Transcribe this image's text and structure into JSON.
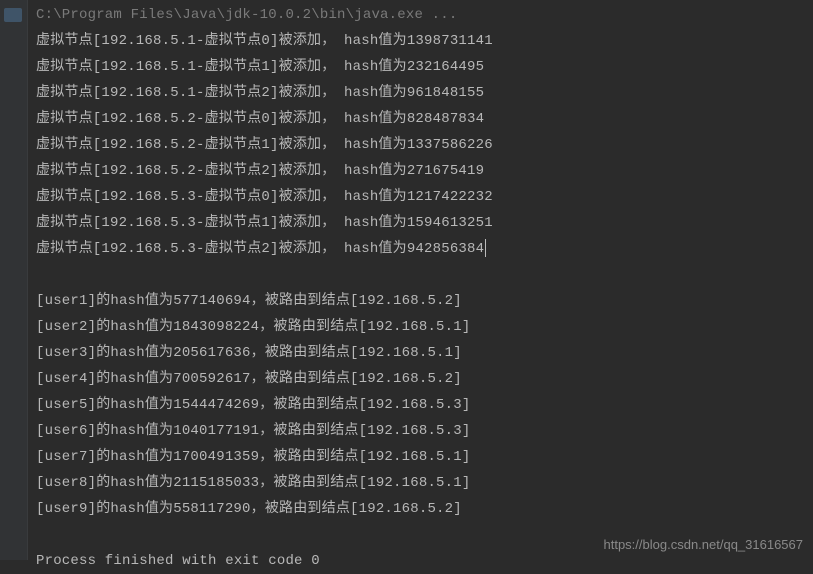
{
  "header_line": "C:\\Program Files\\Java\\jdk-10.0.2\\bin\\java.exe ...",
  "virtual_nodes": [
    "虚拟节点[192.168.5.1-虚拟节点0]被添加， hash值为1398731141",
    "虚拟节点[192.168.5.1-虚拟节点1]被添加， hash值为232164495",
    "虚拟节点[192.168.5.1-虚拟节点2]被添加， hash值为961848155",
    "虚拟节点[192.168.5.2-虚拟节点0]被添加， hash值为828487834",
    "虚拟节点[192.168.5.2-虚拟节点1]被添加， hash值为1337586226",
    "虚拟节点[192.168.5.2-虚拟节点2]被添加， hash值为271675419",
    "虚拟节点[192.168.5.3-虚拟节点0]被添加， hash值为1217422232",
    "虚拟节点[192.168.5.3-虚拟节点1]被添加， hash值为1594613251",
    "虚拟节点[192.168.5.3-虚拟节点2]被添加， hash值为942856384"
  ],
  "routing": [
    "[user1]的hash值为577140694，被路由到结点[192.168.5.2]",
    "[user2]的hash值为1843098224，被路由到结点[192.168.5.1]",
    "[user3]的hash值为205617636，被路由到结点[192.168.5.1]",
    "[user4]的hash值为700592617，被路由到结点[192.168.5.2]",
    "[user5]的hash值为1544474269，被路由到结点[192.168.5.3]",
    "[user6]的hash值为1040177191，被路由到结点[192.168.5.3]",
    "[user7]的hash值为1700491359，被路由到结点[192.168.5.1]",
    "[user8]的hash值为2115185033，被路由到结点[192.168.5.1]",
    "[user9]的hash值为558117290，被路由到结点[192.168.5.2]"
  ],
  "exit_line": "Process finished with exit code 0",
  "watermark": "https://blog.csdn.net/qq_31616567"
}
